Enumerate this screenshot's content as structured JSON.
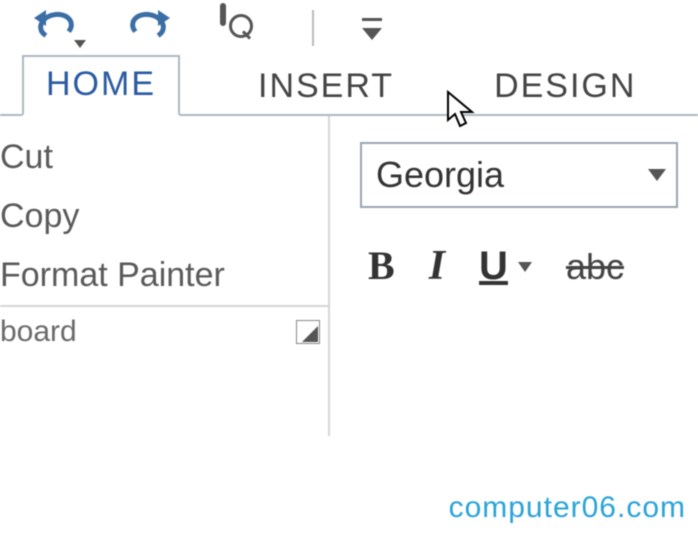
{
  "qat": {
    "undo": "undo",
    "redo": "redo",
    "preview": "print-preview",
    "customize": "customize-quick-access"
  },
  "tabs": {
    "home": "HOME",
    "insert": "INSERT",
    "design": "DESIGN"
  },
  "clipboard": {
    "cut": "Cut",
    "copy": "Copy",
    "format_painter": "Format Painter",
    "group_label": "board"
  },
  "font": {
    "name": "Georgia",
    "bold": "B",
    "italic": "I",
    "underline": "U",
    "strike": "abc"
  },
  "watermark": "computer06.com"
}
